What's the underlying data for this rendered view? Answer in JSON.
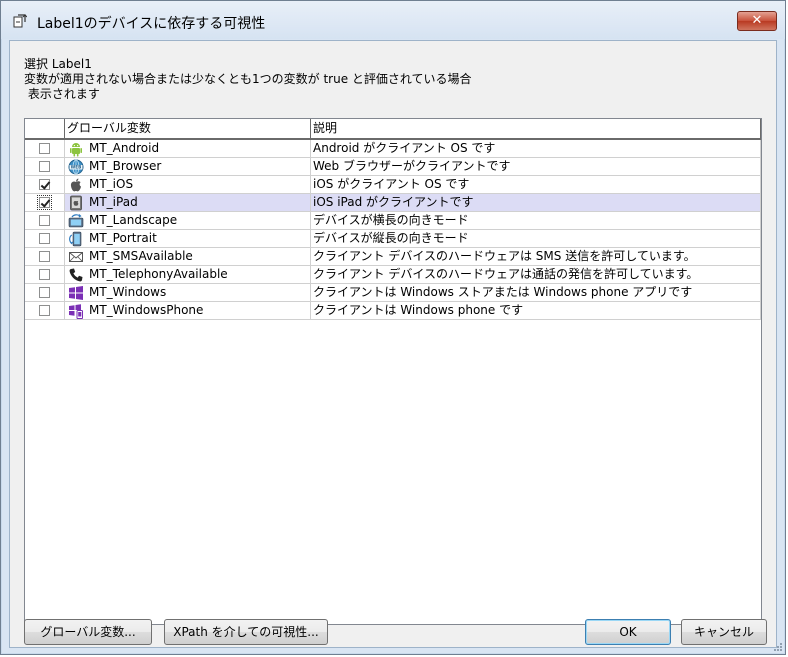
{
  "window": {
    "title": "Label1のデバイスに依存する可視性",
    "close_glyph": "✕"
  },
  "description": {
    "line1": "選択 Label1",
    "line2": "変数が適用されない場合または少なくとも1つの変数が true と評価されている場合",
    "line3": " 表示されます"
  },
  "grid": {
    "columns": [
      "",
      "グローバル変数",
      "説明"
    ],
    "rows": [
      {
        "checked": false,
        "name": "MT_Android",
        "icon": "android-icon",
        "description": "Android がクライアント OS です"
      },
      {
        "checked": false,
        "name": "MT_Browser",
        "icon": "web-browser-icon",
        "description": "Web ブラウザーがクライアントです"
      },
      {
        "checked": true,
        "name": "MT_iOS",
        "icon": "apple-icon",
        "description": "iOS がクライアント OS です"
      },
      {
        "checked": true,
        "name": "MT_iPad",
        "icon": "ipad-icon",
        "description": "iOS iPad がクライアントです",
        "selected": true
      },
      {
        "checked": false,
        "name": "MT_Landscape",
        "icon": "landscape-device-icon",
        "description": "デバイスが横長の向きモード"
      },
      {
        "checked": false,
        "name": "MT_Portrait",
        "icon": "portrait-device-icon",
        "description": "デバイスが縦長の向きモード"
      },
      {
        "checked": false,
        "name": "MT_SMSAvailable",
        "icon": "envelope-icon",
        "description": "クライアント デバイスのハードウェアは SMS 送信を許可しています。"
      },
      {
        "checked": false,
        "name": "MT_TelephonyAvailable",
        "icon": "phone-icon",
        "description": "クライアント デバイスのハードウェアは通話の発信を許可しています。"
      },
      {
        "checked": false,
        "name": "MT_Windows",
        "icon": "windows-logo-icon",
        "description": "クライアントは Windows ストアまたは Windows phone アプリです"
      },
      {
        "checked": false,
        "name": "MT_WindowsPhone",
        "icon": "windows-phone-icon",
        "description": "クライアントは Windows phone です"
      }
    ]
  },
  "buttons": {
    "global_vars": "グローバル変数...",
    "xpath": "XPath を介しての可視性...",
    "ok": "OK",
    "cancel": "キャンセル"
  },
  "colors": {
    "selected_row": "#dcdcf5",
    "title_bar": "#d6e3f2",
    "close_button": "#c8513a"
  }
}
